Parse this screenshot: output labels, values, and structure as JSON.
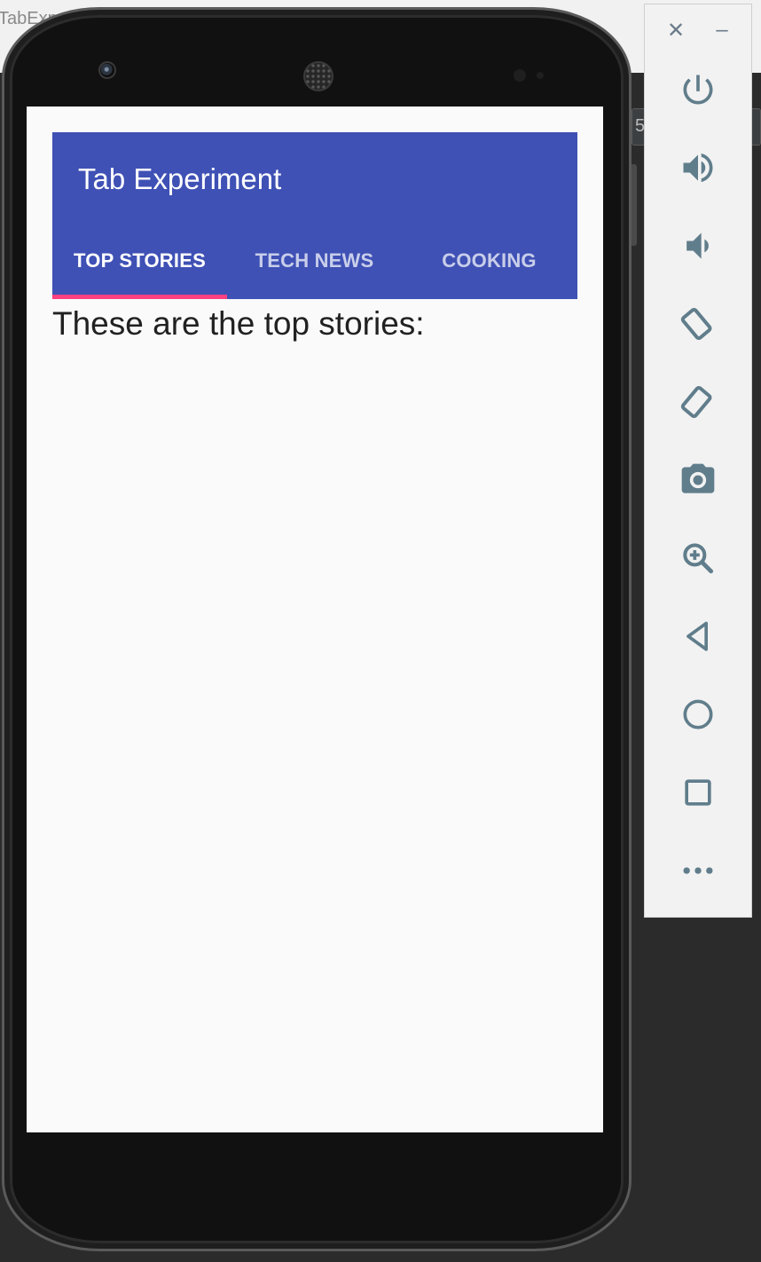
{
  "ide": {
    "title_fragment": "TabExp",
    "field_fragment": "5"
  },
  "app": {
    "title": "Tab Experiment",
    "tabs": [
      {
        "label": "TOP STORIES",
        "selected": true
      },
      {
        "label": "TECH NEWS",
        "selected": false
      },
      {
        "label": "COOKING",
        "selected": false
      }
    ],
    "content_text": "These are the top stories:"
  },
  "colors": {
    "primary": "#3f51b5",
    "accent": "#ff4081",
    "toolbar_icon": "#607d8b"
  },
  "toolbar": {
    "close_glyph": "✕",
    "minimize_glyph": "–",
    "buttons": [
      "power-icon",
      "volume-up-icon",
      "volume-down-icon",
      "rotate-left-icon",
      "rotate-right-icon",
      "camera-icon",
      "zoom-icon",
      "back-icon",
      "home-icon",
      "overview-icon",
      "more-icon"
    ]
  }
}
